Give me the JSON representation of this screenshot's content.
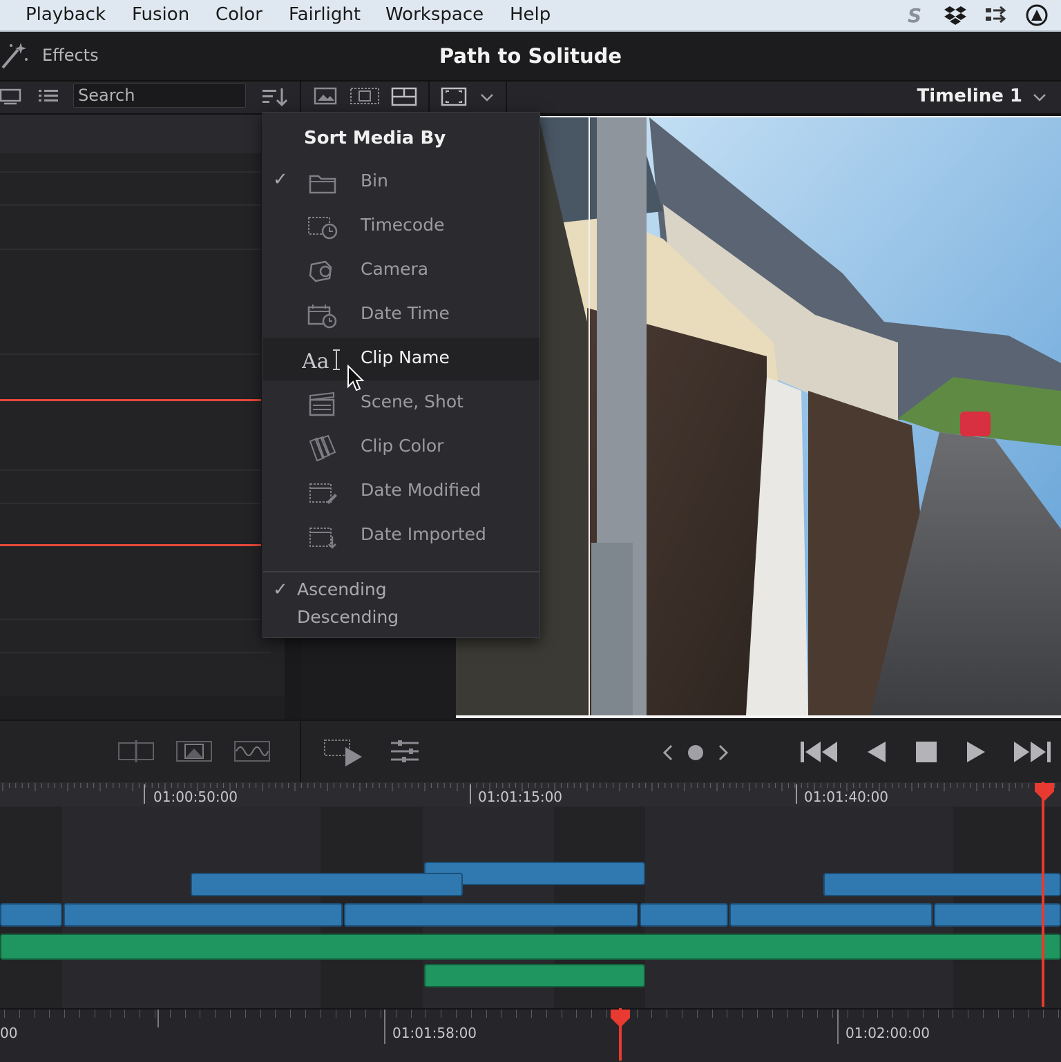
{
  "menubar": {
    "items": [
      "Playback",
      "Fusion",
      "Color",
      "Fairlight",
      "Workspace",
      "Help"
    ]
  },
  "titlebar": {
    "effects_label": "Effects",
    "project_title": "Path to Solitude"
  },
  "toolbar": {
    "search_placeholder": "Search",
    "timeline_name": "Timeline 1"
  },
  "sort_menu": {
    "heading": "Sort Media By",
    "items": [
      {
        "label": "Bin",
        "icon": "folder-icon",
        "checked": true
      },
      {
        "label": "Timecode",
        "icon": "timecode-clock-icon",
        "checked": false
      },
      {
        "label": "Camera",
        "icon": "camera-icon",
        "checked": false
      },
      {
        "label": "Date Time",
        "icon": "calendar-clock-icon",
        "checked": false
      },
      {
        "label": "Clip Name",
        "icon": "text-aa-icon",
        "checked": false,
        "highlighted": true
      },
      {
        "label": "Scene, Shot",
        "icon": "clapperboard-icon",
        "checked": false
      },
      {
        "label": "Clip Color",
        "icon": "color-swatch-icon",
        "checked": false
      },
      {
        "label": "Date Modified",
        "icon": "calendar-edit-icon",
        "checked": false
      },
      {
        "label": "Date Imported",
        "icon": "calendar-import-icon",
        "checked": false
      }
    ],
    "order": {
      "ascending": "Ascending",
      "descending": "Descending",
      "selected": "Ascending"
    }
  },
  "timeline": {
    "ruler_labels": [
      "01:00:50:00",
      "01:01:15:00",
      "01:01:40:00"
    ],
    "lower_ruler_labels": [
      "00",
      "01:01:58:00",
      "01:02:00:00"
    ]
  },
  "colors": {
    "accent_red": "#e83a30",
    "video_clip": "#2f79b0",
    "audio_clip": "#1f9560"
  }
}
